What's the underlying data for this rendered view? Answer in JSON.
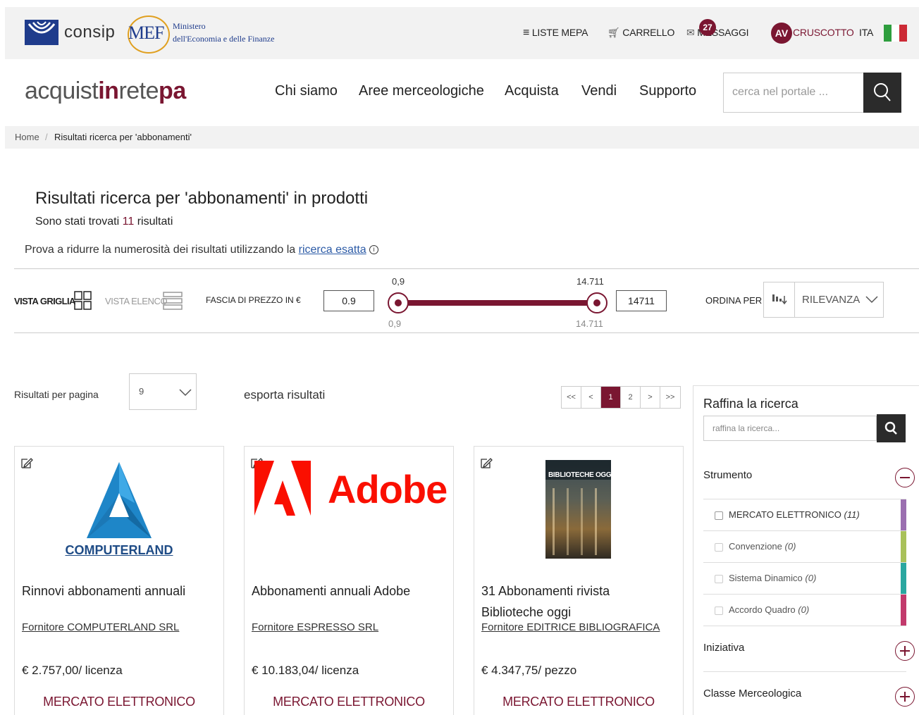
{
  "topbar": {
    "consip": "consip",
    "mef": "MEF",
    "ministero_line1": "Ministero",
    "ministero_line2": "dell'Economia e delle Finanze",
    "liste_mepa": "LISTE MEPA",
    "carrello": "CARRELLO",
    "messaggi": "MESSAGGI",
    "messaggi_count": "27",
    "avatar_initials": "AV",
    "cruscotto": "CRUSCOTTO",
    "language": "ITA"
  },
  "header": {
    "brand_a": "acquist",
    "brand_in": "in",
    "brand_rete": "rete",
    "brand_pa": "pa",
    "nav": [
      "Chi siamo",
      "Aree merceologiche",
      "Acquista",
      "Vendi",
      "Supporto"
    ],
    "search_placeholder": "cerca nel portale ..."
  },
  "breadcrumb": {
    "home": "Home",
    "separator": "/",
    "current": "Risultati ricerca per 'abbonamenti'"
  },
  "results": {
    "title": "Risultati ricerca per 'abbonamenti' in prodotti",
    "count_prefix": "Sono stati trovati",
    "count": "11",
    "count_suffix": "risultati",
    "hint_text": "Prova a ridurre la numerosità dei risultati utilizzando la",
    "hint_link": "ricerca esatta"
  },
  "filters": {
    "vista_griglia": "VISTA GRIGLIA",
    "vista_elenco": "VISTA ELENCO",
    "fascia_label": "FASCIA DI PREZZO IN €",
    "price_min_input": "0.9",
    "price_max_input": "14711",
    "slider_min_top": "0,9",
    "slider_max_top": "14.711",
    "slider_min_bottom": "0,9",
    "slider_max_bottom": "14.711",
    "slider_low_fraction": 0,
    "slider_high_fraction": 1,
    "ordina_label": "ORDINA PER",
    "ordina_value": "RILEVANZA"
  },
  "listing": {
    "rpp_label": "Risultati per pagina",
    "rpp_value": "9",
    "export": "esporta risultati",
    "pager": [
      "<<",
      "<",
      "1",
      "2",
      ">",
      ">>"
    ],
    "pager_active": "1"
  },
  "cards": [
    {
      "logo_text": "COMPUTERLAND",
      "title": "Rinnovi abbonamenti annuali",
      "supplier": "Fornitore COMPUTERLAND SRL",
      "price": "€ 2.757,00/ licenza",
      "tag": "MERCATO ELETTRONICO"
    },
    {
      "logo_text": "Adobe",
      "title": "Abbonamenti annuali Adobe",
      "supplier": "Fornitore ESPRESSO SRL",
      "price": "€ 10.183,04/ licenza",
      "tag": "MERCATO ELETTRONICO"
    },
    {
      "logo_text": "BIBLIOTECHE OGGI",
      "title": "31 Abbonamenti rivista Biblioteche oggi",
      "supplier": "Fornitore EDITRICE BIBLIOGRAFICA",
      "price": "€ 4.347,75/ pezzo",
      "tag": "MERCATO ELETTRONICO"
    }
  ],
  "sidebar": {
    "title": "Raffina la ricerca",
    "refine_placeholder": "raffina la ricerca...",
    "strumento": "Strumento",
    "options": [
      {
        "label": "MERCATO ELETTRONICO",
        "count": "(11)",
        "color": "#9b6fb0"
      },
      {
        "label": "Convenzione",
        "count": "(0)",
        "color": "#a9c15a"
      },
      {
        "label": "Sistema Dinamico",
        "count": "(0)",
        "color": "#2aa7a0"
      },
      {
        "label": "Accordo Quadro",
        "count": "(0)",
        "color": "#c23a6c"
      }
    ],
    "iniziativa": "Iniziativa",
    "classe": "Classe Merceologica"
  },
  "colors": {
    "accent": "#7a1631",
    "dark": "#2b2b2b"
  }
}
